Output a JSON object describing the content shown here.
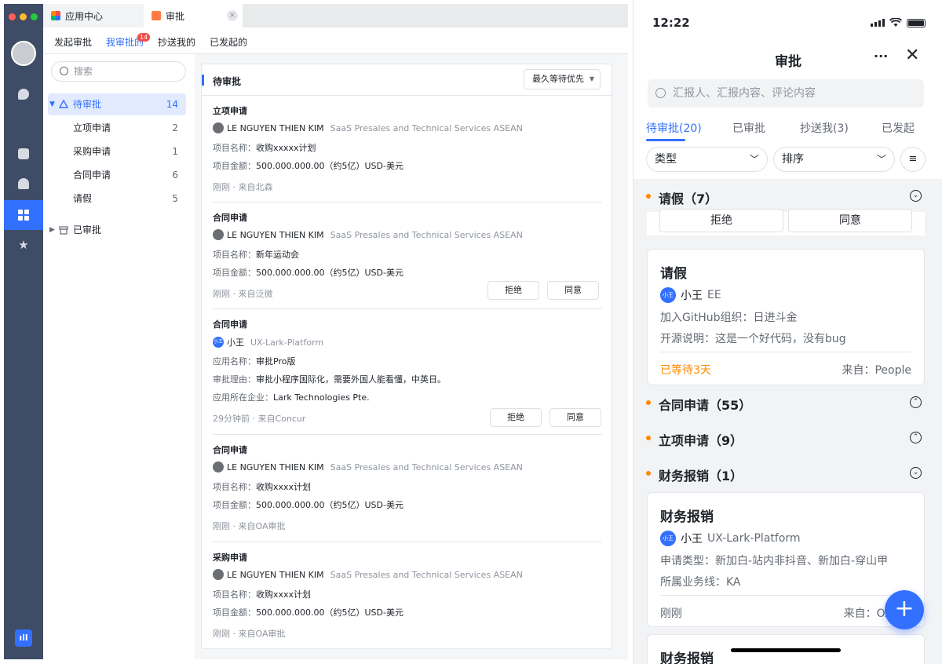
{
  "desktop": {
    "window_tabs": [
      {
        "label": "应用中心"
      },
      {
        "label": "审批"
      }
    ],
    "close_glyph": "×",
    "subnav": [
      {
        "label": "发起审批"
      },
      {
        "label": "我审批的"
      },
      {
        "label": "抄送我的"
      },
      {
        "label": "已发起的"
      }
    ],
    "subnav_badge": "14",
    "search_placeholder": "搜索",
    "tree": {
      "pending": {
        "label": "待审批",
        "count": "14"
      },
      "children": [
        {
          "label": "立项申请",
          "count": "2"
        },
        {
          "label": "采购申请",
          "count": "1"
        },
        {
          "label": "合同申请",
          "count": "6"
        },
        {
          "label": "请假",
          "count": "5"
        }
      ],
      "done": {
        "label": "已审批"
      }
    },
    "panel": {
      "title": "待审批",
      "sort_label": "最久等待优先"
    },
    "cards": [
      {
        "title": "立项申请",
        "name": "LE NGUYEN THIEN KIM",
        "org": "SaaS Presales and Technical Services ASEAN",
        "lines": [
          [
            "项目名称：",
            "收购xxxxx计划"
          ],
          [
            "项目金额：",
            "500.000.000.00（约5亿）USD-美元"
          ]
        ],
        "footer": "刚刚 · 来自北森"
      },
      {
        "title": "合同申请",
        "name": "LE NGUYEN THIEN KIM",
        "org": "SaaS Presales and Technical Services ASEAN",
        "lines": [
          [
            "项目名称：",
            "新年运动会"
          ],
          [
            "项目金额：",
            "500.000.000.00（约5亿）USD-美元"
          ]
        ],
        "footer": "刚刚 · 来自泛微",
        "reject": "拒绝",
        "approve": "同意"
      },
      {
        "title": "合同申请",
        "avatar_text": "小王",
        "name": "小王",
        "org": "UX-Lark-Platform",
        "lines": [
          [
            "应用名称：",
            "审批Pro版"
          ],
          [
            "审批理由：",
            "审批小程序国际化，需要外国人能看懂，中英日。"
          ],
          [
            "应用所在企业：",
            "Lark Technologies Pte."
          ]
        ],
        "footer": "29分钟前 · 来自Concur",
        "reject": "拒绝",
        "approve": "同意"
      },
      {
        "title": "合同申请",
        "name": "LE NGUYEN THIEN KIM",
        "org": "SaaS Presales and Technical Services ASEAN",
        "lines": [
          [
            "项目名称：",
            "收购xxxx计划"
          ],
          [
            "项目金额：",
            "500.000.000.00（约5亿）USD-美元"
          ]
        ],
        "footer": "刚刚 · 来自OA审批"
      },
      {
        "title": "采购申请",
        "name": "LE NGUYEN THIEN KIM",
        "org": "SaaS Presales and Technical Services ASEAN",
        "lines": [
          [
            "项目名称：",
            "收购xxxx计划"
          ],
          [
            "项目金额：",
            "500.000.000.00（约5亿）USD-美元"
          ]
        ],
        "footer": "刚刚 · 来自OA审批"
      }
    ],
    "accent_color": "#3370ff",
    "rail_color": "#3f4c66"
  },
  "mobile": {
    "time": "12:22",
    "title": "审批",
    "more_glyph": "···",
    "close_glyph": "✕",
    "search_placeholder": "汇报人、汇报内容、评论内容",
    "tabs": [
      {
        "label": "待审批(20)"
      },
      {
        "label": "已审批"
      },
      {
        "label": "抄送我(3)"
      },
      {
        "label": "已发起"
      }
    ],
    "filter_type": "类型",
    "filter_sort": "排序",
    "groups": [
      {
        "label": "请假（7）"
      },
      {
        "label": "合同申请（55）"
      },
      {
        "label": "立项申请（9）"
      },
      {
        "label": "财务报销（1）"
      }
    ],
    "top_buttons": {
      "reject": "拒绝",
      "approve": "同意"
    },
    "leave_card": {
      "title": "请假",
      "avatar_text": "小王",
      "name": "小王",
      "org": "EE",
      "line1": "加入GitHub组织：日进斗金",
      "line2": "开源说明：这是一个好代码，没有bug",
      "wait": "已等待3天",
      "source": "来自：People"
    },
    "expense_card": {
      "title": "财务报销",
      "avatar_text": "小王",
      "name": "小王",
      "org": "UX-Lark-Platform",
      "line1": "申请类型：新加白-站内非抖音、新加白-穿山甲",
      "line2": "所属业务线：KA",
      "time": "刚刚",
      "source": "来自：OA"
    },
    "next_card_title": "财务报销",
    "fab_glyph": "+",
    "wait_color": "#ff8800"
  }
}
